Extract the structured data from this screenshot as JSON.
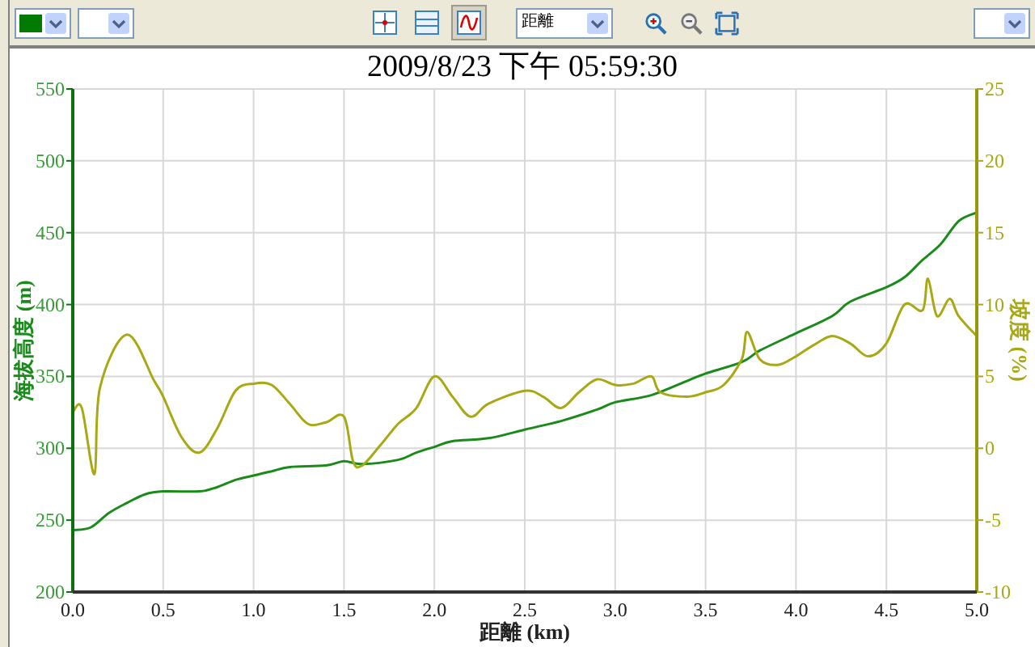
{
  "toolbar": {
    "line_color": {
      "color": "#007a00"
    },
    "view_buttons": [
      {
        "kind": "crosshair",
        "selected": false
      },
      {
        "kind": "split",
        "selected": false
      },
      {
        "kind": "curve",
        "selected": true
      }
    ],
    "axis_dropdown": {
      "value": "距離"
    },
    "zoom_buttons": [
      {
        "kind": "zoom-in"
      },
      {
        "kind": "zoom-out"
      },
      {
        "kind": "fit"
      }
    ]
  },
  "chart": {
    "title": "2009/8/23 下午 05:59:30",
    "chart_data": {
      "type": "line",
      "grid": true,
      "xlabel": "距離 (km)",
      "ylabel": "海拔高度 (m)",
      "y2label": "坡度 (%)",
      "xlim": [
        0,
        5
      ],
      "ylim": [
        200,
        550
      ],
      "y2lim": [
        -10,
        25
      ],
      "xticks": [
        {
          "value": 0,
          "label": "0.0"
        },
        {
          "value": 0.5,
          "label": "0.5"
        },
        {
          "value": 1,
          "label": "1.0"
        },
        {
          "value": 1.5,
          "label": "1.5"
        },
        {
          "value": 2,
          "label": "2.0"
        },
        {
          "value": 2.5,
          "label": "2.5"
        },
        {
          "value": 3,
          "label": "3.0"
        },
        {
          "value": 3.5,
          "label": "3.5"
        },
        {
          "value": 4,
          "label": "4.0"
        },
        {
          "value": 4.5,
          "label": "4.5"
        },
        {
          "value": 5,
          "label": "5.0"
        }
      ],
      "yticks": [
        200,
        250,
        300,
        350,
        400,
        450,
        500,
        550
      ],
      "y2ticks": [
        -10,
        -5,
        0,
        5,
        10,
        15,
        20,
        25
      ],
      "series": [
        {
          "color": "#1a8a1a",
          "x": [
            0,
            0.1,
            0.2,
            0.3,
            0.4,
            0.5,
            0.7,
            0.8,
            0.9,
            1.0,
            1.1,
            1.2,
            1.4,
            1.5,
            1.6,
            1.8,
            1.9,
            2.0,
            2.1,
            2.3,
            2.5,
            2.7,
            2.9,
            3.0,
            3.2,
            3.4,
            3.5,
            3.7,
            3.8,
            4.0,
            4.2,
            4.3,
            4.5,
            4.6,
            4.7,
            4.8,
            4.9,
            5.0
          ],
          "values": [
            243,
            245,
            255,
            262,
            268,
            270,
            270,
            273,
            278,
            281,
            284,
            287,
            288,
            291,
            289,
            292,
            297,
            301,
            305,
            307,
            313,
            319,
            327,
            332,
            337,
            347,
            352,
            360,
            368,
            380,
            392,
            402,
            412,
            419,
            431,
            442,
            458,
            464
          ]
        },
        {
          "axis": "y2",
          "color": "#a8a814",
          "x": [
            0,
            0.05,
            0.12,
            0.15,
            0.3,
            0.45,
            0.5,
            0.6,
            0.7,
            0.8,
            0.9,
            1.0,
            1.1,
            1.2,
            1.3,
            1.4,
            1.5,
            1.55,
            1.6,
            1.7,
            1.8,
            1.9,
            2.0,
            2.1,
            2.2,
            2.3,
            2.5,
            2.6,
            2.7,
            2.8,
            2.9,
            3.0,
            3.1,
            3.2,
            3.25,
            3.4,
            3.5,
            3.6,
            3.7,
            3.73,
            3.8,
            3.9,
            4.0,
            4.1,
            4.2,
            4.3,
            4.4,
            4.5,
            4.6,
            4.7,
            4.73,
            4.78,
            4.85,
            4.9,
            5.0
          ],
          "values": [
            2.5,
            2.8,
            -1.8,
            4.2,
            7.9,
            4.7,
            3.6,
            0.8,
            -0.3,
            1.4,
            4,
            4.5,
            4.4,
            3.1,
            1.7,
            1.8,
            2.2,
            -0.9,
            -1.2,
            0.2,
            1.7,
            2.8,
            5,
            3.6,
            2.2,
            3.1,
            4,
            3.6,
            2.8,
            3.9,
            4.8,
            4.4,
            4.5,
            5,
            3.9,
            3.6,
            3.9,
            4.4,
            6.2,
            8.1,
            6.2,
            5.8,
            6.4,
            7.2,
            7.8,
            7.3,
            6.4,
            7.3,
            10,
            9.6,
            11.8,
            9.2,
            10.4,
            9.2,
            7.8
          ]
        }
      ]
    }
  }
}
